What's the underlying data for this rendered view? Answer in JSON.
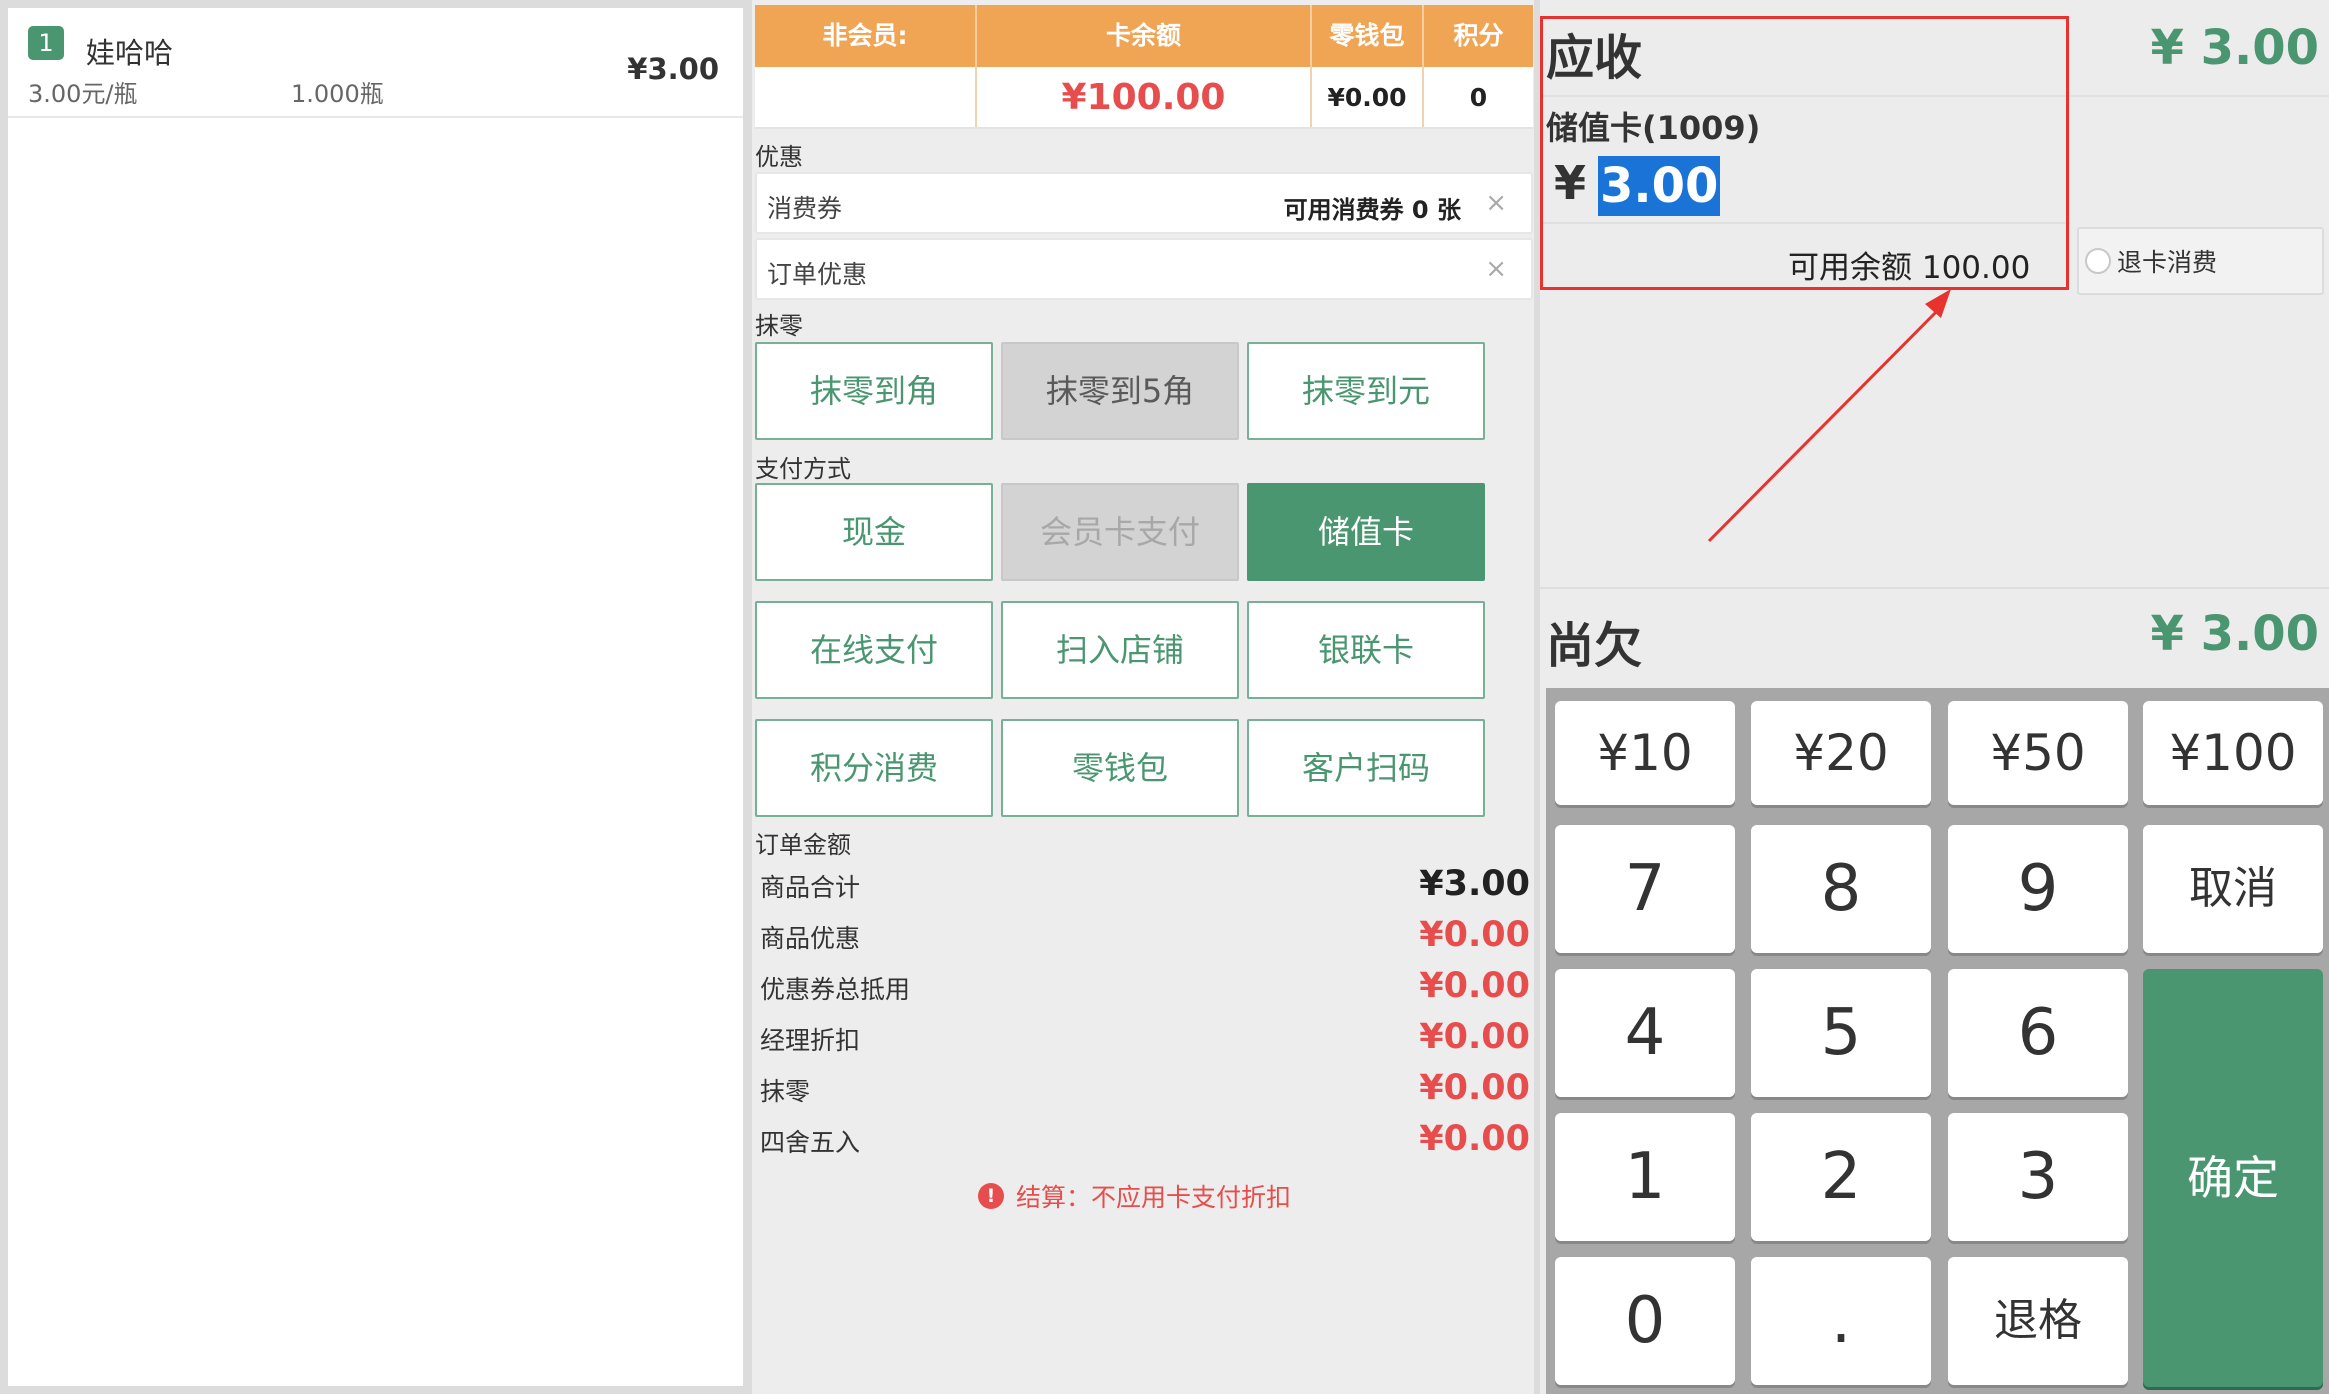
{
  "order": {
    "items": [
      {
        "index": "1",
        "name": "娃哈哈",
        "price": "¥3.00",
        "unit_price": "3.00元/瓶",
        "quantity": "1.000瓶"
      }
    ]
  },
  "member": {
    "headers": {
      "non_member": "非会员:",
      "card_balance": "卡余额",
      "wallet": "零钱包",
      "points": "积分"
    },
    "values": {
      "non_member": "",
      "card_balance": "¥100.00",
      "wallet": "¥0.00",
      "points": "0"
    }
  },
  "discount": {
    "section_label": "优惠",
    "coupon_label": "消费券",
    "coupon_info": "可用消费券 0 张",
    "order_discount_label": "订单优惠",
    "clear_symbol": "×"
  },
  "rounding": {
    "section_label": "抹零",
    "options": [
      "抹零到角",
      "抹零到5角",
      "抹零到元"
    ]
  },
  "payment": {
    "section_label": "支付方式",
    "methods": [
      "现金",
      "会员卡支付",
      "储值卡",
      "在线支付",
      "扫入店铺",
      "银联卡",
      "积分消费",
      "零钱包",
      "客户扫码"
    ]
  },
  "summary": {
    "section_label": "订单金额",
    "rows": [
      {
        "label": "商品合计",
        "value": "¥3.00"
      },
      {
        "label": "商品优惠",
        "value": "¥0.00"
      },
      {
        "label": "优惠券总抵用",
        "value": "¥0.00"
      },
      {
        "label": "经理折扣",
        "value": "¥0.00"
      },
      {
        "label": "抹零",
        "value": "¥0.00"
      },
      {
        "label": "四舍五入",
        "value": "¥0.00"
      }
    ],
    "note_icon": "!",
    "note": "结算：不应用卡支付折扣"
  },
  "checkout": {
    "receivable_label": "应收",
    "receivable_amount": "¥ 3.00",
    "card_label": "储值卡(1009)",
    "currency": "¥",
    "pay_amount": "3.00",
    "available_balance": "可用余额 100.00",
    "refund_option": "退卡消费",
    "owed_label": "尚欠",
    "owed_amount": "¥ 3.00"
  },
  "keypad": {
    "quick_amounts": [
      "¥10",
      "¥20",
      "¥50",
      "¥100"
    ],
    "digits": [
      "7",
      "8",
      "9",
      "4",
      "5",
      "6",
      "1",
      "2",
      "3",
      "0",
      "."
    ],
    "cancel": "取消",
    "confirm": "确定",
    "backspace": "退格"
  },
  "colors": {
    "accent_green": "#4a9670",
    "header_orange": "#f0a555",
    "alert_red": "#e84d4d",
    "highlight_red": "#e8322e",
    "selection_blue": "#1a73d6"
  }
}
